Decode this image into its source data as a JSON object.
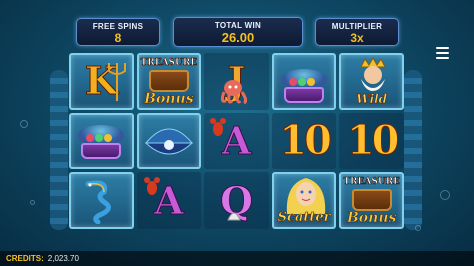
{
  "hud": {
    "free_spins": {
      "label": "FREE SPINS",
      "value": "8"
    },
    "total_win": {
      "label": "TOTAL WIN",
      "value": "26.00"
    },
    "multiplier": {
      "label": "MULTIPLIER",
      "value": "3x"
    }
  },
  "reels": [
    [
      "K",
      "clam-gems",
      "seahorse-dragon"
    ],
    [
      "treasure-bonus",
      "clam-pearl",
      "A"
    ],
    [
      "J",
      "A",
      "Q"
    ],
    [
      "clam-gems",
      "10",
      "mermaid-scatter"
    ],
    [
      "king-wild",
      "10",
      "treasure-bonus"
    ]
  ],
  "symbol_text": {
    "K": "K",
    "A": "A",
    "Q": "Q",
    "J": "J",
    "ten": "10",
    "treasure": "TREASURE",
    "bonus": "Bonus",
    "scatter": "Scatter",
    "wild": "Wild"
  },
  "credits": {
    "label": "CREDITS:",
    "value": "2,023.70"
  },
  "colors": {
    "accent_gold": "#f5c020",
    "panel_border": "#5a8fd0",
    "frame_border": "#7fd1f0"
  },
  "icons": {
    "menu": "hamburger-menu-icon"
  }
}
